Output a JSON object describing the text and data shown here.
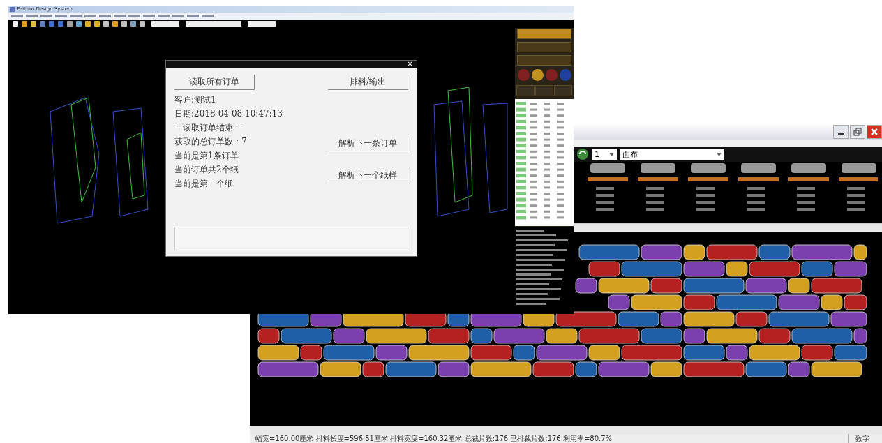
{
  "main_window": {
    "title": "Pattern Design System"
  },
  "dialog": {
    "buttons": [
      {
        "label": "读取所有订单"
      },
      {
        "label": "排料/输出"
      }
    ],
    "lines": [
      "客户:测试1",
      "日期:2018-04-08 10:47:13",
      "---读取订单结束---",
      "获取的总订单数：7",
      "当前是第1条订单",
      "当前订单共2个纸",
      "当前是第一个纸"
    ],
    "side_buttons": [
      "解析下一条订单",
      "解析下一个纸样"
    ]
  },
  "marker_window": {
    "combos": [
      {
        "value": "1"
      },
      {
        "value": "面布"
      }
    ],
    "status_bar": {
      "text": "幅宽=160.00厘米 排料长度=596.51厘米 排料宽度=160.32厘米 总裁片数:176 已排裁片数:176 利用率=80.7%",
      "mode": "数字"
    }
  }
}
